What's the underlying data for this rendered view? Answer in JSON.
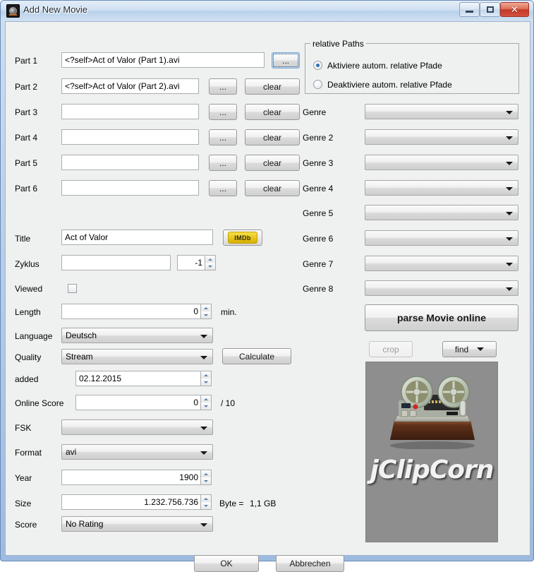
{
  "window": {
    "title": "Add New Movie",
    "icon": "film-reel-icon",
    "minimize_label": "Minimize",
    "maximize_label": "Maximize",
    "close_label": "Close"
  },
  "parts": [
    {
      "label": "Part 1",
      "value": "<?self>Act of Valor (Part 1).avi",
      "browse_label": "...",
      "clear_label": "clear",
      "has_clear": false,
      "browse_focused": true
    },
    {
      "label": "Part 2",
      "value": "<?self>Act of Valor (Part 2).avi",
      "browse_label": "...",
      "clear_label": "clear",
      "has_clear": true,
      "browse_focused": false
    },
    {
      "label": "Part 3",
      "value": "",
      "browse_label": "...",
      "clear_label": "clear",
      "has_clear": true,
      "browse_focused": false
    },
    {
      "label": "Part 4",
      "value": "",
      "browse_label": "...",
      "clear_label": "clear",
      "has_clear": true,
      "browse_focused": false
    },
    {
      "label": "Part 5",
      "value": "",
      "browse_label": "...",
      "clear_label": "clear",
      "has_clear": true,
      "browse_focused": false
    },
    {
      "label": "Part 6",
      "value": "",
      "browse_label": "...",
      "clear_label": "clear",
      "has_clear": true,
      "browse_focused": false
    }
  ],
  "relative_paths": {
    "group_title": "relative Paths",
    "option_enable": "Aktiviere autom. relative Pfade",
    "option_disable": "Deaktiviere autom. relative Pfade",
    "selected": "enable"
  },
  "genres": [
    {
      "label": "Genre",
      "value": ""
    },
    {
      "label": "Genre 2",
      "value": ""
    },
    {
      "label": "Genre 3",
      "value": ""
    },
    {
      "label": "Genre 4",
      "value": ""
    },
    {
      "label": "Genre 5",
      "value": ""
    },
    {
      "label": "Genre 6",
      "value": ""
    },
    {
      "label": "Genre 7",
      "value": ""
    },
    {
      "label": "Genre 8",
      "value": ""
    }
  ],
  "form": {
    "title_label": "Title",
    "title_value": "Act of Valor",
    "imdb_label": "IMDb",
    "zyklus_label": "Zyklus",
    "zyklus_value": "",
    "zyklus_number": "-1",
    "viewed_label": "Viewed",
    "viewed_checked": false,
    "length_label": "Length",
    "length_value": "0",
    "length_unit": "min.",
    "language_label": "Language",
    "language_value": "Deutsch",
    "quality_label": "Quality",
    "quality_value": "Stream",
    "calculate_label": "Calculate",
    "added_label": "added",
    "added_value": "02.12.2015",
    "online_score_label": "Online Score",
    "online_score_value": "0",
    "online_score_suffix": "/ 10",
    "fsk_label": "FSK",
    "fsk_value": "",
    "format_label": "Format",
    "format_value": "avi",
    "year_label": "Year",
    "year_value": "1900",
    "size_label": "Size",
    "size_value": "1.232.756.736",
    "size_unit": "Byte =",
    "size_human": "1,1 GB",
    "score_label": "Score",
    "score_value": "No Rating"
  },
  "right_panel": {
    "parse_label": "parse Movie online",
    "crop_label": "crop",
    "crop_disabled": true,
    "find_label": "find",
    "cover_caption": "jClipCorn"
  },
  "footer": {
    "ok_label": "OK",
    "cancel_label": "Abbrechen"
  },
  "colors": {
    "window_frame": "#9dbbe0",
    "client_bg": "#eff0f0",
    "close_button": "#c4392a",
    "radio_dot": "#2f6fb5",
    "imdb_yellow": "#e8c51a",
    "cover_bg": "#8e8e8e"
  }
}
